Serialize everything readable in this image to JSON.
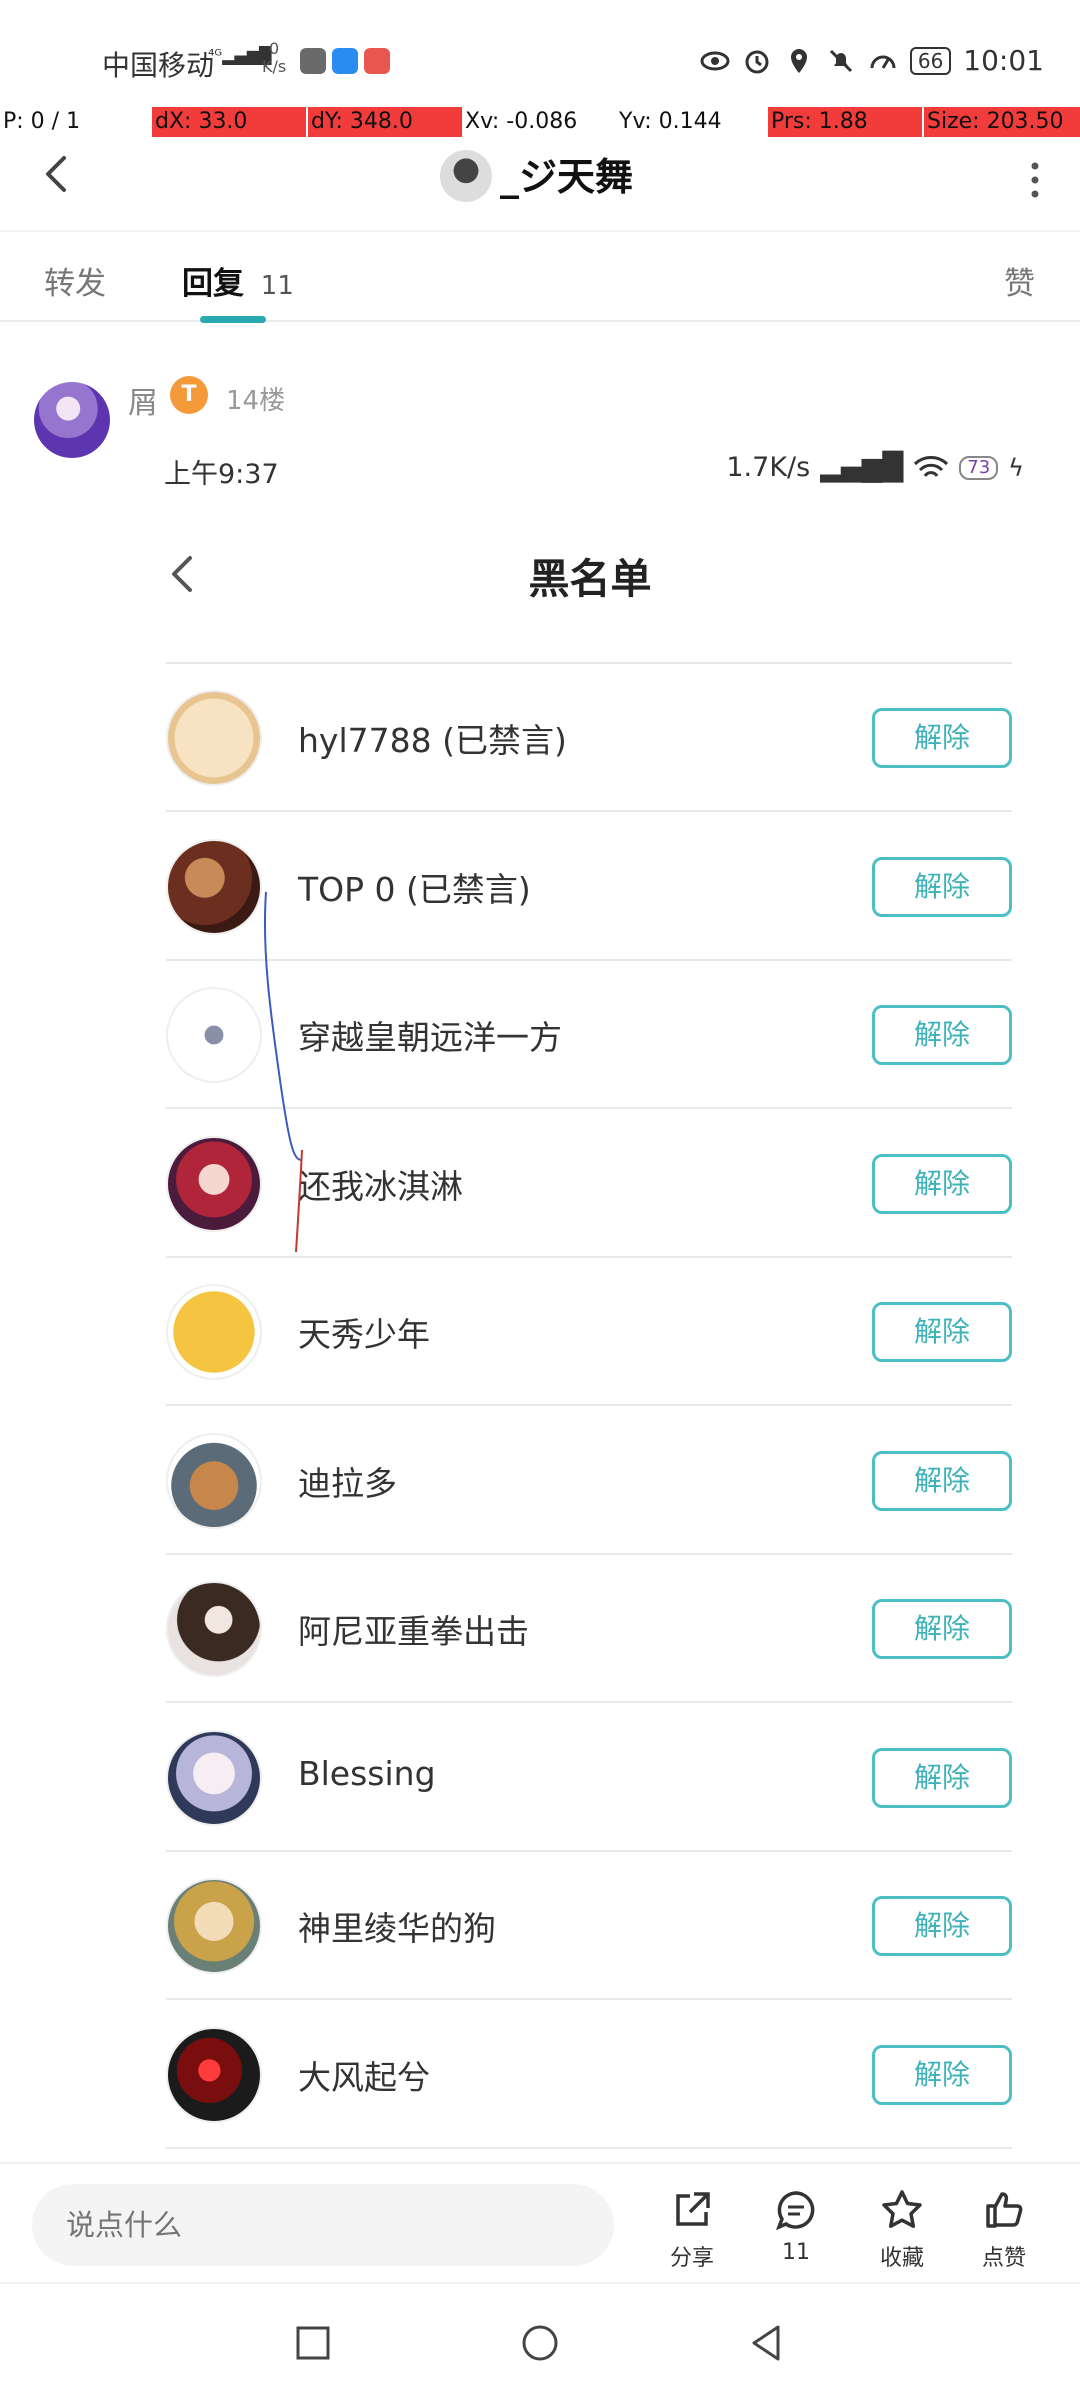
{
  "status_bar": {
    "carrier": "中国移动",
    "net_speed_value": "0",
    "net_speed_unit": "K/s",
    "battery": "66",
    "time": "10:01"
  },
  "pointer_overlay": {
    "p": "P: 0 / 1",
    "dx": "dX: 33.0",
    "dy": "dY: 348.0",
    "xv": "Xv: -0.086",
    "yv": "Yv: 0.144",
    "prs": "Prs: 1.88",
    "size": "Size: 203.50"
  },
  "header": {
    "title": "_ジ天舞"
  },
  "tabs": {
    "forward": "转发",
    "reply": "回复",
    "reply_count": "11",
    "like": "赞"
  },
  "reply": {
    "username": "屑",
    "badge": "T",
    "floor": "14楼"
  },
  "embedded_screenshot": {
    "time": "上午9:37",
    "net_speed": "1.7K/s",
    "battery": "73",
    "title": "黑名单",
    "unblock_label": "解除",
    "users": [
      {
        "name": "hyl7788 (已禁言)"
      },
      {
        "name": "TOP  0 (已禁言)"
      },
      {
        "name": "穿越皇朝远洋一方"
      },
      {
        "name": "还我冰淇淋"
      },
      {
        "name": "天秀少年"
      },
      {
        "name": "迪拉多"
      },
      {
        "name": "阿尼亚重拳出击"
      },
      {
        "name": "Blessing"
      },
      {
        "name": "神里绫华的狗"
      },
      {
        "name": "大风起兮"
      }
    ]
  },
  "bottom_bar": {
    "comment_placeholder": "说点什么",
    "share": "分享",
    "comment_count": "11",
    "favorite": "收藏",
    "like": "点赞"
  },
  "colors": {
    "accent": "#2aa9b3",
    "button_border": "#4cbfc4",
    "overlay_red": "#f23b3b"
  }
}
